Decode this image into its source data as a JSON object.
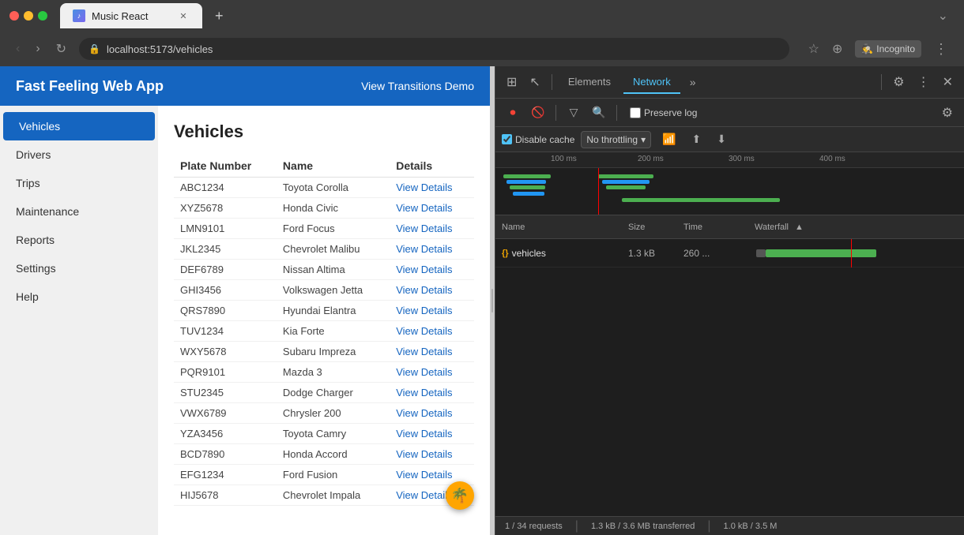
{
  "browser": {
    "tab_title": "Music React",
    "url": "localhost:5173/vehicles",
    "incognito_label": "Incognito"
  },
  "webapp": {
    "header_title": "Fast Feeling Web App",
    "nav_link": "View Transitions Demo",
    "sidebar": {
      "items": [
        {
          "label": "Vehicles",
          "active": true
        },
        {
          "label": "Drivers"
        },
        {
          "label": "Trips"
        },
        {
          "label": "Maintenance"
        },
        {
          "label": "Reports"
        },
        {
          "label": "Settings"
        },
        {
          "label": "Help"
        }
      ]
    },
    "page_title": "Vehicles",
    "table": {
      "columns": [
        "Plate Number",
        "Name",
        "Details"
      ],
      "rows": [
        {
          "plate": "ABC1234",
          "name": "Toyota Corolla",
          "link": "View Details"
        },
        {
          "plate": "XYZ5678",
          "name": "Honda Civic",
          "link": "View Details"
        },
        {
          "plate": "LMN9101",
          "name": "Ford Focus",
          "link": "View Details"
        },
        {
          "plate": "JKL2345",
          "name": "Chevrolet Malibu",
          "link": "View Details"
        },
        {
          "plate": "DEF6789",
          "name": "Nissan Altima",
          "link": "View Details"
        },
        {
          "plate": "GHI3456",
          "name": "Volkswagen Jetta",
          "link": "View Details"
        },
        {
          "plate": "QRS7890",
          "name": "Hyundai Elantra",
          "link": "View Details"
        },
        {
          "plate": "TUV1234",
          "name": "Kia Forte",
          "link": "View Details"
        },
        {
          "plate": "WXY5678",
          "name": "Subaru Impreza",
          "link": "View Details"
        },
        {
          "plate": "PQR9101",
          "name": "Mazda 3",
          "link": "View Details"
        },
        {
          "plate": "STU2345",
          "name": "Dodge Charger",
          "link": "View Details"
        },
        {
          "plate": "VWX6789",
          "name": "Chrysler 200",
          "link": "View Details"
        },
        {
          "plate": "YZA3456",
          "name": "Toyota Camry",
          "link": "View Details"
        },
        {
          "plate": "BCD7890",
          "name": "Honda Accord",
          "link": "View Details"
        },
        {
          "plate": "EFG1234",
          "name": "Ford Fusion",
          "link": "View Details"
        },
        {
          "plate": "HIJ5678",
          "name": "Chevrolet Impala",
          "link": "View Details"
        }
      ]
    }
  },
  "devtools": {
    "tabs": [
      "Elements",
      "Network"
    ],
    "active_tab": "Network",
    "toolbar": {
      "preserve_log": "Preserve log",
      "disable_cache": "Disable cache",
      "throttle": "No throttling"
    },
    "timeline_marks": [
      "100 ms",
      "200 ms",
      "300 ms",
      "400 ms"
    ],
    "table": {
      "columns": [
        "Name",
        "Size",
        "Time",
        "Waterfall"
      ],
      "rows": [
        {
          "name": "vehicles",
          "icon": "{}",
          "size": "1.3 kB",
          "time": "260 ..."
        }
      ]
    },
    "footer": {
      "requests": "1 / 34 requests",
      "transferred": "1.3 kB / 3.6 MB transferred",
      "resources": "1.0 kB / 3.5 M"
    }
  }
}
